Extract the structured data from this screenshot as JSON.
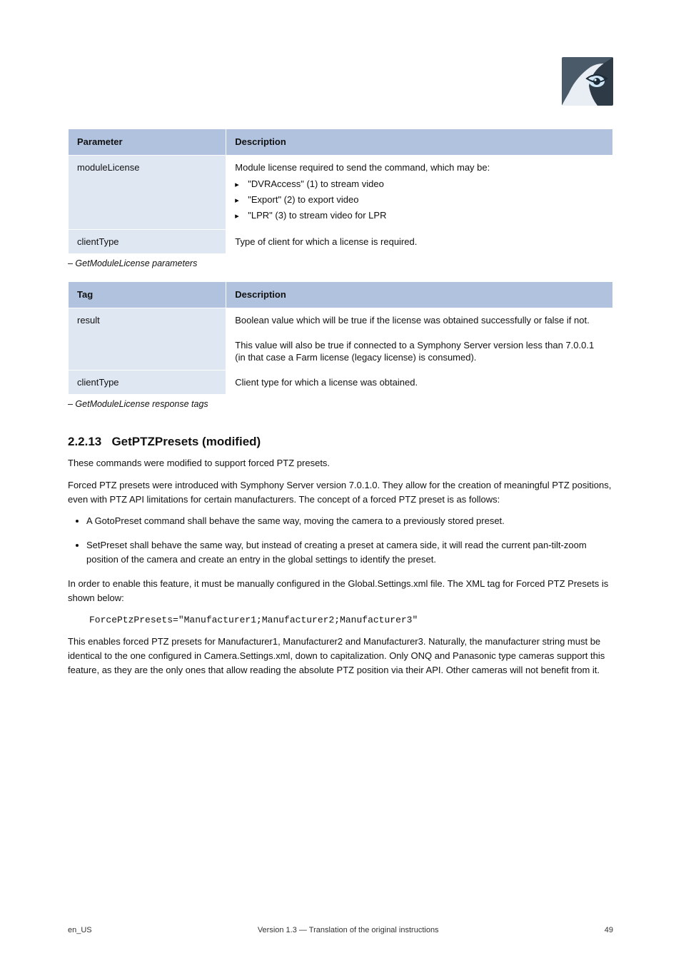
{
  "table1": {
    "h1": "Parameter",
    "h2": "Description",
    "rows": [
      {
        "label": "moduleLicense",
        "value_intro": "Module license required to send the command, which may be:",
        "items": [
          "\"DVRAccess\" (1) to stream video",
          "\"Export\" (2) to export video",
          "\"LPR\"  (3) to stream video for LPR"
        ]
      },
      {
        "label": "clientType",
        "value": "Type of client for which a license is required."
      }
    ],
    "caption": "– GetModuleLicense parameters"
  },
  "table2": {
    "h1": "Tag",
    "h2": "Description",
    "rows": [
      {
        "label": "result",
        "value": "Boolean value which will be true if the license was obtained successfully or false if not.\n\nThis value will also be true if connected to a Symphony Server version less than 7.0.0.1 (in that case a Farm license (legacy license) is consumed)."
      },
      {
        "label": "clientType",
        "value": "Client type for which a license was obtained."
      }
    ],
    "caption": "– GetModuleLicense response tags"
  },
  "section": {
    "number": "2.2.13",
    "title": "GetPTZPresets (modified)",
    "p1": "These commands were modified to support forced PTZ presets.",
    "intro": "Forced PTZ presets were introduced with Symphony Server version 7.0.1.0. They allow for the creation of meaningful PTZ positions, even with PTZ API limitations for certain manufacturers. The concept of a forced PTZ preset is as follows:",
    "bullets": [
      "A GotoPreset command shall behave the same way, moving the camera to a previously stored preset.",
      "SetPreset shall behave the same way, but instead of creating a preset at camera side, it will read the current pan-tilt-zoom position of the camera and create an entry in the global settings to identify the preset."
    ],
    "p2": "In order to enable this feature, it must be manually configured in the Global.Settings.xml file. The XML tag for Forced PTZ Presets is shown below:",
    "xml": "ForcePtzPresets=\"Manufacturer1;Manufacturer2;Manufacturer3\"",
    "p3": "This enables forced PTZ presets for Manufacturer1, Manufacturer2 and Manufacturer3. Naturally, the manufacturer string must be identical to the one configured in Camera.Settings.xml, down to capitalization. Only ONQ and Panasonic type cameras support this feature, as they are the only ones that allow reading the absolute PTZ position via their API. Other cameras will not benefit from it."
  },
  "footer": {
    "left": "en_US",
    "center": "Version 1.3 — Translation of the original instructions",
    "right": "49"
  }
}
